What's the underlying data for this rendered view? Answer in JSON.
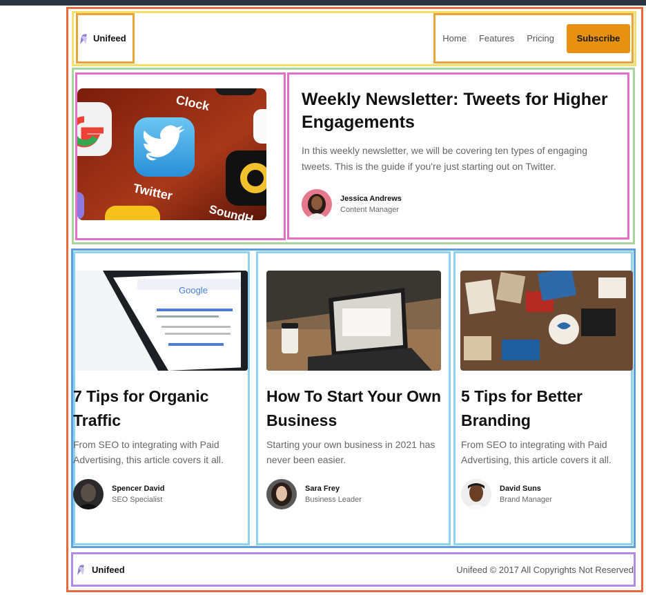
{
  "brand": {
    "name": "Unifeed"
  },
  "nav": {
    "links": [
      "Home",
      "Features",
      "Pricing"
    ],
    "cta": "Subscribe",
    "cta_color": "#e8900f"
  },
  "hero": {
    "image_alt_icons": [
      "google-icon",
      "twitter-icon",
      "clock-icon",
      "soundhound-icon"
    ],
    "app_labels": [
      "Clock",
      "Twitter",
      "SoundH"
    ],
    "title": "Weekly Newsletter: Tweets for Higher Engagements",
    "description": "In this weekly newsletter, we will be covering ten types of engaging tweets. This is the guide if you're just starting out on Twitter.",
    "author": {
      "name": "Jessica Andrews",
      "role": "Content Manager"
    }
  },
  "cards": [
    {
      "title": "7 Tips for Organic Traffic",
      "description": "From SEO to integrating with Paid Advertising, this article covers it all.",
      "author": {
        "name": "Spencer David",
        "role": "SEO Specialist"
      }
    },
    {
      "title": "How To Start Your Own Business",
      "description": "Starting your own business in 2021 has never been easier.",
      "author": {
        "name": "Sara Frey",
        "role": "Business Leader"
      }
    },
    {
      "title": "5 Tips for Better Branding",
      "description": "From SEO to integrating with Paid Advertising, this article covers it all.",
      "author": {
        "name": "David Suns",
        "role": "Brand Manager"
      }
    }
  ],
  "footer": {
    "brand": "Unifeed",
    "copyright": "Unifeed © 2017 All Copyrights Not Reserved"
  }
}
